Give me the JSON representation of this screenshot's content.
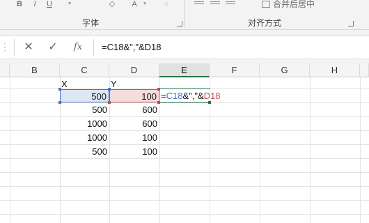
{
  "colors": {
    "accent": "#217346",
    "ref_c": "#4472c4",
    "ref_d": "#c0504d"
  },
  "ribbon": {
    "bold_label": "B",
    "italic_label": "I",
    "underline_label": "U",
    "fill_label": "◇",
    "fontcolor_label": "A",
    "clear_label": "♢",
    "merge_label": "合并后居中",
    "group_font": "字体",
    "group_align": "对齐方式"
  },
  "formula_bar": {
    "cancel_icon": "✕",
    "enter_icon": "✓",
    "fx_label": "fx",
    "formula": "=C18&\",\"&D18"
  },
  "columns": [
    "B",
    "C",
    "D",
    "E",
    "F",
    "G",
    "H"
  ],
  "active_column": "E",
  "table": {
    "header_x": "X",
    "header_y": "Y",
    "rows": [
      {
        "x": "500",
        "y": "100"
      },
      {
        "x": "500",
        "y": "600"
      },
      {
        "x": "1000",
        "y": "600"
      },
      {
        "x": "1000",
        "y": "100"
      },
      {
        "x": "500",
        "y": "100"
      }
    ]
  },
  "edit_cell": {
    "eq": "=",
    "ref1": "C18",
    "op": "&\",\"&",
    "ref2": "D18"
  }
}
